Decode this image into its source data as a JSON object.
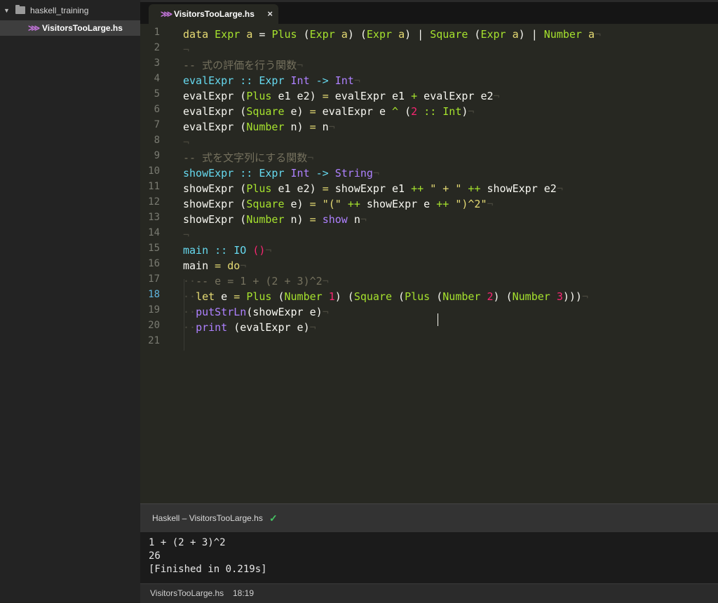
{
  "sidebar": {
    "folder_name": "haskell_training",
    "file_name": "VisitorsTooLarge.hs"
  },
  "tab": {
    "label": "VisitorsTooLarge.hs",
    "close": "×"
  },
  "icons": {
    "folder": "folder-icon",
    "haskell_file": "haskell-file-icon",
    "chevron": "chevron-down-icon",
    "close": "close-icon",
    "check": "check-icon"
  },
  "gutter": [
    "1",
    "2",
    "3",
    "4",
    "5",
    "6",
    "7",
    "8",
    "9",
    "10",
    "11",
    "12",
    "13",
    "14",
    "15",
    "16",
    "17",
    "18",
    "19",
    "20",
    "21"
  ],
  "active_line": "18",
  "code": [
    [
      [
        "y",
        "data"
      ],
      [
        "w",
        " "
      ],
      [
        "g",
        "Expr"
      ],
      [
        "w",
        " "
      ],
      [
        "y",
        "a"
      ],
      [
        "w",
        " = "
      ],
      [
        "g",
        "Plus"
      ],
      [
        "w",
        " ("
      ],
      [
        "g",
        "Expr"
      ],
      [
        "w",
        " "
      ],
      [
        "y",
        "a"
      ],
      [
        "w",
        ") ("
      ],
      [
        "g",
        "Expr"
      ],
      [
        "w",
        " "
      ],
      [
        "y",
        "a"
      ],
      [
        "w",
        ") | "
      ],
      [
        "g",
        "Square"
      ],
      [
        "w",
        " ("
      ],
      [
        "g",
        "Expr"
      ],
      [
        "w",
        " "
      ],
      [
        "y",
        "a"
      ],
      [
        "w",
        ") | "
      ],
      [
        "g",
        "Number"
      ],
      [
        "w",
        " "
      ],
      [
        "y",
        "a"
      ],
      [
        "inv",
        "¬"
      ]
    ],
    [
      [
        "inv",
        "¬"
      ]
    ],
    [
      [
        "cm",
        "-- 式の評価を行う関数"
      ],
      [
        "inv",
        "¬"
      ]
    ],
    [
      [
        "c",
        "evalExpr"
      ],
      [
        "w",
        " "
      ],
      [
        "c",
        "::"
      ],
      [
        "w",
        " "
      ],
      [
        "c",
        "Expr"
      ],
      [
        "w",
        " "
      ],
      [
        "p",
        "Int"
      ],
      [
        "w",
        " "
      ],
      [
        "c",
        "->"
      ],
      [
        "w",
        " "
      ],
      [
        "p",
        "Int"
      ],
      [
        "inv",
        "¬"
      ]
    ],
    [
      [
        "w",
        "evalExpr ("
      ],
      [
        "g",
        "Plus"
      ],
      [
        "w",
        " e1 e2) "
      ],
      [
        "y",
        "="
      ],
      [
        "w",
        " evalExpr e1 "
      ],
      [
        "g",
        "+"
      ],
      [
        "w",
        " evalExpr e2"
      ],
      [
        "inv",
        "¬"
      ]
    ],
    [
      [
        "w",
        "evalExpr ("
      ],
      [
        "g",
        "Square"
      ],
      [
        "w",
        " e) "
      ],
      [
        "y",
        "="
      ],
      [
        "w",
        " evalExpr e "
      ],
      [
        "g",
        "^"
      ],
      [
        "w",
        " ("
      ],
      [
        "r",
        "2"
      ],
      [
        "w",
        " "
      ],
      [
        "g",
        "::"
      ],
      [
        "w",
        " "
      ],
      [
        "g",
        "Int"
      ],
      [
        "w",
        ")"
      ],
      [
        "inv",
        "¬"
      ]
    ],
    [
      [
        "w",
        "evalExpr ("
      ],
      [
        "g",
        "Number"
      ],
      [
        "w",
        " n) "
      ],
      [
        "y",
        "="
      ],
      [
        "w",
        " n"
      ],
      [
        "inv",
        "¬"
      ]
    ],
    [
      [
        "inv",
        "¬"
      ]
    ],
    [
      [
        "cm",
        "-- 式を文字列にする関数"
      ],
      [
        "inv",
        "¬"
      ]
    ],
    [
      [
        "c",
        "showExpr"
      ],
      [
        "w",
        " "
      ],
      [
        "c",
        "::"
      ],
      [
        "w",
        " "
      ],
      [
        "c",
        "Expr"
      ],
      [
        "w",
        " "
      ],
      [
        "p",
        "Int"
      ],
      [
        "w",
        " "
      ],
      [
        "c",
        "->"
      ],
      [
        "w",
        " "
      ],
      [
        "p",
        "String"
      ],
      [
        "inv",
        "¬"
      ]
    ],
    [
      [
        "w",
        "showExpr ("
      ],
      [
        "g",
        "Plus"
      ],
      [
        "w",
        " e1 e2) "
      ],
      [
        "y",
        "="
      ],
      [
        "w",
        " showExpr e1 "
      ],
      [
        "g",
        "++"
      ],
      [
        "w",
        " "
      ],
      [
        "y",
        "\" + \""
      ],
      [
        "w",
        " "
      ],
      [
        "g",
        "++"
      ],
      [
        "w",
        " showExpr e2"
      ],
      [
        "inv",
        "¬"
      ]
    ],
    [
      [
        "w",
        "showExpr ("
      ],
      [
        "g",
        "Square"
      ],
      [
        "w",
        " e) "
      ],
      [
        "y",
        "="
      ],
      [
        "w",
        " "
      ],
      [
        "y",
        "\"(\""
      ],
      [
        "w",
        " "
      ],
      [
        "g",
        "++"
      ],
      [
        "w",
        " showExpr e "
      ],
      [
        "g",
        "++"
      ],
      [
        "w",
        " "
      ],
      [
        "y",
        "\")^2\""
      ],
      [
        "inv",
        "¬"
      ]
    ],
    [
      [
        "w",
        "showExpr ("
      ],
      [
        "g",
        "Number"
      ],
      [
        "w",
        " n) "
      ],
      [
        "y",
        "="
      ],
      [
        "w",
        " "
      ],
      [
        "p",
        "show"
      ],
      [
        "w",
        " n"
      ],
      [
        "inv",
        "¬"
      ]
    ],
    [
      [
        "inv",
        "¬"
      ]
    ],
    [
      [
        "c",
        "main"
      ],
      [
        "w",
        " "
      ],
      [
        "c",
        "::"
      ],
      [
        "w",
        " "
      ],
      [
        "c",
        "IO"
      ],
      [
        "w",
        " "
      ],
      [
        "r",
        "()"
      ],
      [
        "inv",
        "¬"
      ]
    ],
    [
      [
        "w",
        "main "
      ],
      [
        "y",
        "="
      ],
      [
        "w",
        " "
      ],
      [
        "y",
        "do"
      ],
      [
        "inv",
        "¬"
      ]
    ],
    [
      [
        "inv",
        "··"
      ],
      [
        "cm",
        "-- e = 1 + (2 + 3)^2"
      ],
      [
        "inv",
        "¬"
      ]
    ],
    [
      [
        "inv",
        "··"
      ],
      [
        "y",
        "let"
      ],
      [
        "w",
        " e "
      ],
      [
        "y",
        "="
      ],
      [
        "w",
        " "
      ],
      [
        "g",
        "Plus"
      ],
      [
        "w",
        " ("
      ],
      [
        "g",
        "Number"
      ],
      [
        "w",
        " "
      ],
      [
        "r",
        "1"
      ],
      [
        "w",
        ") ("
      ],
      [
        "g",
        "Square"
      ],
      [
        "w",
        " ("
      ],
      [
        "g",
        "Plus"
      ],
      [
        "w",
        " ("
      ],
      [
        "g",
        "Number"
      ],
      [
        "w",
        " "
      ],
      [
        "r",
        "2"
      ],
      [
        "w",
        ") ("
      ],
      [
        "g",
        "Number"
      ],
      [
        "w",
        " "
      ],
      [
        "r",
        "3"
      ],
      [
        "w",
        ")))"
      ],
      [
        "inv",
        "¬"
      ]
    ],
    [
      [
        "inv",
        "··"
      ],
      [
        "p",
        "putStrLn"
      ],
      [
        "w",
        "(showExpr e)"
      ],
      [
        "inv",
        "¬"
      ]
    ],
    [
      [
        "inv",
        "··"
      ],
      [
        "p",
        "print"
      ],
      [
        "w",
        " (evalExpr e)"
      ],
      [
        "inv",
        "¬"
      ]
    ],
    []
  ],
  "panel": {
    "title": "Haskell – VisitorsTooLarge.hs",
    "check": "✓"
  },
  "output": [
    "1 + (2 + 3)^2",
    "26",
    "[Finished in 0.219s]"
  ],
  "status": {
    "file": "VisitorsTooLarge.hs",
    "position": "18:19"
  }
}
